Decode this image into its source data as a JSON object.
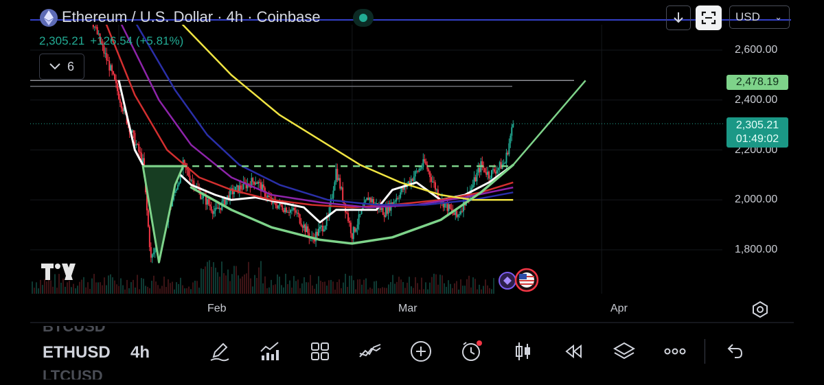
{
  "header": {
    "title": "Ethereum / U.S. Dollar · 4h · Coinbase",
    "last_price": "2,305.21",
    "change": "+126.54 (+5.81%)",
    "indicator_count": "6",
    "currency": "USD"
  },
  "price_tags": {
    "level_tag": "2,478.19",
    "current_price": "2,305.21",
    "countdown": "01:49:02"
  },
  "bottom_bar": {
    "symbol_ghost_top": "BTCUSD",
    "symbol": "ETHUSD",
    "symbol_ghost_bottom": "LTCUSD",
    "interval": "4h",
    "tools": [
      "pencil-icon",
      "chart-line-icon",
      "grid-icon",
      "compare-icon",
      "add-icon",
      "alert-clock-icon",
      "candles-icon",
      "replay-icon",
      "layers-icon",
      "more-icon",
      "undo-icon"
    ]
  },
  "colors": {
    "bullish": "#22ab94",
    "bearish": "#f23645",
    "pattern": "#7ed38a",
    "ma_white": "#ffffff",
    "ma_yellow": "#f0e442",
    "ma_red": "#d32f2f",
    "ma_purple": "#8e24aa",
    "ma_blue": "#2a2fa8"
  },
  "chart_data": {
    "type": "line",
    "symbol": "ETHUSD",
    "interval": "4h",
    "y_ticks": [
      1800,
      2000,
      2200,
      2400,
      2600
    ],
    "y_tick_labels": [
      "1,800.00",
      "2,000.00",
      "2,200.00",
      "2,400.00",
      "2,600.00"
    ],
    "x_ticks": [
      {
        "label": "Feb",
        "x": "2024-02-01"
      },
      {
        "label": "Mar",
        "x": "2024-03-01"
      },
      {
        "label": "Apr",
        "x": "2024-04-01"
      }
    ],
    "ylim": [
      1650,
      2760
    ],
    "xlim": [
      "2024-01-21",
      "2024-04-16"
    ],
    "price_path": [
      {
        "x": "2024-01-25",
        "y": 2900
      },
      {
        "x": "2024-01-28",
        "y": 2780
      },
      {
        "x": "2024-01-31",
        "y": 2520
      },
      {
        "x": "2024-02-02",
        "y": 2320
      },
      {
        "x": "2024-02-04",
        "y": 2150
      },
      {
        "x": "2024-02-05",
        "y": 1760
      },
      {
        "x": "2024-02-07",
        "y": 1930
      },
      {
        "x": "2024-02-09",
        "y": 2140
      },
      {
        "x": "2024-02-11",
        "y": 2030
      },
      {
        "x": "2024-02-13",
        "y": 1950
      },
      {
        "x": "2024-02-15",
        "y": 2030
      },
      {
        "x": "2024-02-18",
        "y": 2080
      },
      {
        "x": "2024-02-20",
        "y": 1990
      },
      {
        "x": "2024-02-23",
        "y": 1950
      },
      {
        "x": "2024-02-25",
        "y": 1840
      },
      {
        "x": "2024-02-27",
        "y": 1920
      },
      {
        "x": "2024-02-28",
        "y": 2120
      },
      {
        "x": "2024-03-01",
        "y": 1860
      },
      {
        "x": "2024-03-03",
        "y": 2010
      },
      {
        "x": "2024-03-05",
        "y": 1950
      },
      {
        "x": "2024-03-07",
        "y": 2030
      },
      {
        "x": "2024-03-10",
        "y": 2150
      },
      {
        "x": "2024-03-12",
        "y": 2000
      },
      {
        "x": "2024-03-14",
        "y": 1930
      },
      {
        "x": "2024-03-16",
        "y": 2060
      },
      {
        "x": "2024-03-17",
        "y": 2140
      },
      {
        "x": "2024-03-18",
        "y": 2100
      },
      {
        "x": "2024-03-20",
        "y": 2150
      },
      {
        "x": "2024-03-21",
        "y": 2305
      }
    ],
    "series": [
      {
        "color": "#ffffff",
        "points": [
          {
            "x": "2024-02-01",
            "y": 2480
          },
          {
            "x": "2024-02-03",
            "y": 2200
          },
          {
            "x": "2024-02-05",
            "y": 2080
          },
          {
            "x": "2024-02-07",
            "y": 2030
          },
          {
            "x": "2024-02-08",
            "y": 2120
          },
          {
            "x": "2024-02-10",
            "y": 2060
          },
          {
            "x": "2024-02-13",
            "y": 2020
          },
          {
            "x": "2024-02-15",
            "y": 2000
          },
          {
            "x": "2024-02-18",
            "y": 2010
          },
          {
            "x": "2024-02-21",
            "y": 1990
          },
          {
            "x": "2024-02-24",
            "y": 1970
          },
          {
            "x": "2024-02-26",
            "y": 1910
          },
          {
            "x": "2024-02-28",
            "y": 1960
          },
          {
            "x": "2024-03-01",
            "y": 1960
          },
          {
            "x": "2024-03-04",
            "y": 1960
          },
          {
            "x": "2024-03-06",
            "y": 2040
          },
          {
            "x": "2024-03-09",
            "y": 2070
          },
          {
            "x": "2024-03-12",
            "y": 2000
          },
          {
            "x": "2024-03-15",
            "y": 2020
          },
          {
            "x": "2024-03-18",
            "y": 2070
          },
          {
            "x": "2024-03-21",
            "y": 2140
          }
        ]
      },
      {
        "color": "#d32f2f",
        "points": [
          {
            "x": "2024-01-28",
            "y": 2900
          },
          {
            "x": "2024-01-31",
            "y": 2660
          },
          {
            "x": "2024-02-03",
            "y": 2420
          },
          {
            "x": "2024-02-07",
            "y": 2200
          },
          {
            "x": "2024-02-11",
            "y": 2090
          },
          {
            "x": "2024-02-15",
            "y": 2040
          },
          {
            "x": "2024-02-20",
            "y": 2000
          },
          {
            "x": "2024-02-25",
            "y": 1980
          },
          {
            "x": "2024-03-01",
            "y": 1970
          },
          {
            "x": "2024-03-06",
            "y": 1980
          },
          {
            "x": "2024-03-12",
            "y": 2000
          },
          {
            "x": "2024-03-17",
            "y": 2030
          },
          {
            "x": "2024-03-21",
            "y": 2070
          }
        ]
      },
      {
        "color": "#8e24aa",
        "points": [
          {
            "x": "2024-01-29",
            "y": 2920
          },
          {
            "x": "2024-02-02",
            "y": 2660
          },
          {
            "x": "2024-02-06",
            "y": 2400
          },
          {
            "x": "2024-02-10",
            "y": 2220
          },
          {
            "x": "2024-02-15",
            "y": 2090
          },
          {
            "x": "2024-02-20",
            "y": 2020
          },
          {
            "x": "2024-02-26",
            "y": 1990
          },
          {
            "x": "2024-03-03",
            "y": 1970
          },
          {
            "x": "2024-03-09",
            "y": 1980
          },
          {
            "x": "2024-03-15",
            "y": 2010
          },
          {
            "x": "2024-03-21",
            "y": 2050
          }
        ]
      },
      {
        "color": "#2a2fa8",
        "points": [
          {
            "x": "2024-01-31",
            "y": 2880
          },
          {
            "x": "2024-02-04",
            "y": 2660
          },
          {
            "x": "2024-02-08",
            "y": 2440
          },
          {
            "x": "2024-02-12",
            "y": 2260
          },
          {
            "x": "2024-02-16",
            "y": 2140
          },
          {
            "x": "2024-02-21",
            "y": 2060
          },
          {
            "x": "2024-02-27",
            "y": 2000
          },
          {
            "x": "2024-03-04",
            "y": 1980
          },
          {
            "x": "2024-03-10",
            "y": 1980
          },
          {
            "x": "2024-03-16",
            "y": 2000
          },
          {
            "x": "2024-03-21",
            "y": 2030
          }
        ]
      },
      {
        "color": "#f0e442",
        "points": [
          {
            "x": "2024-02-04",
            "y": 2900
          },
          {
            "x": "2024-02-09",
            "y": 2700
          },
          {
            "x": "2024-02-15",
            "y": 2500
          },
          {
            "x": "2024-02-21",
            "y": 2340
          },
          {
            "x": "2024-02-27",
            "y": 2220
          },
          {
            "x": "2024-03-02",
            "y": 2140
          },
          {
            "x": "2024-03-07",
            "y": 2070
          },
          {
            "x": "2024-03-12",
            "y": 2020
          },
          {
            "x": "2024-03-16",
            "y": 2000
          },
          {
            "x": "2024-03-21",
            "y": 2000
          }
        ]
      }
    ],
    "pattern": {
      "neckline": 2135,
      "neckline_start": "2024-02-04",
      "neckline_end": "2024-03-21",
      "flag_spike": [
        {
          "x": "2024-02-04",
          "y": 2135
        },
        {
          "x": "2024-02-06",
          "y": 1750
        },
        {
          "x": "2024-02-08",
          "y": 2060
        },
        {
          "x": "2024-02-09",
          "y": 2135
        }
      ],
      "cup": [
        {
          "x": "2024-02-10",
          "y": 2050
        },
        {
          "x": "2024-02-15",
          "y": 1960
        },
        {
          "x": "2024-02-20",
          "y": 1890
        },
        {
          "x": "2024-02-26",
          "y": 1840
        },
        {
          "x": "2024-03-01",
          "y": 1825
        },
        {
          "x": "2024-03-06",
          "y": 1850
        },
        {
          "x": "2024-03-12",
          "y": 1920
        },
        {
          "x": "2024-03-17",
          "y": 2030
        },
        {
          "x": "2024-03-21",
          "y": 2140
        }
      ],
      "projection": [
        {
          "x": "2024-03-21",
          "y": 2140
        },
        {
          "x": "2024-03-30",
          "y": 2478.19
        }
      ],
      "target_level": 2478.19
    },
    "price_lines": [
      2478.19,
      2305.21
    ]
  }
}
